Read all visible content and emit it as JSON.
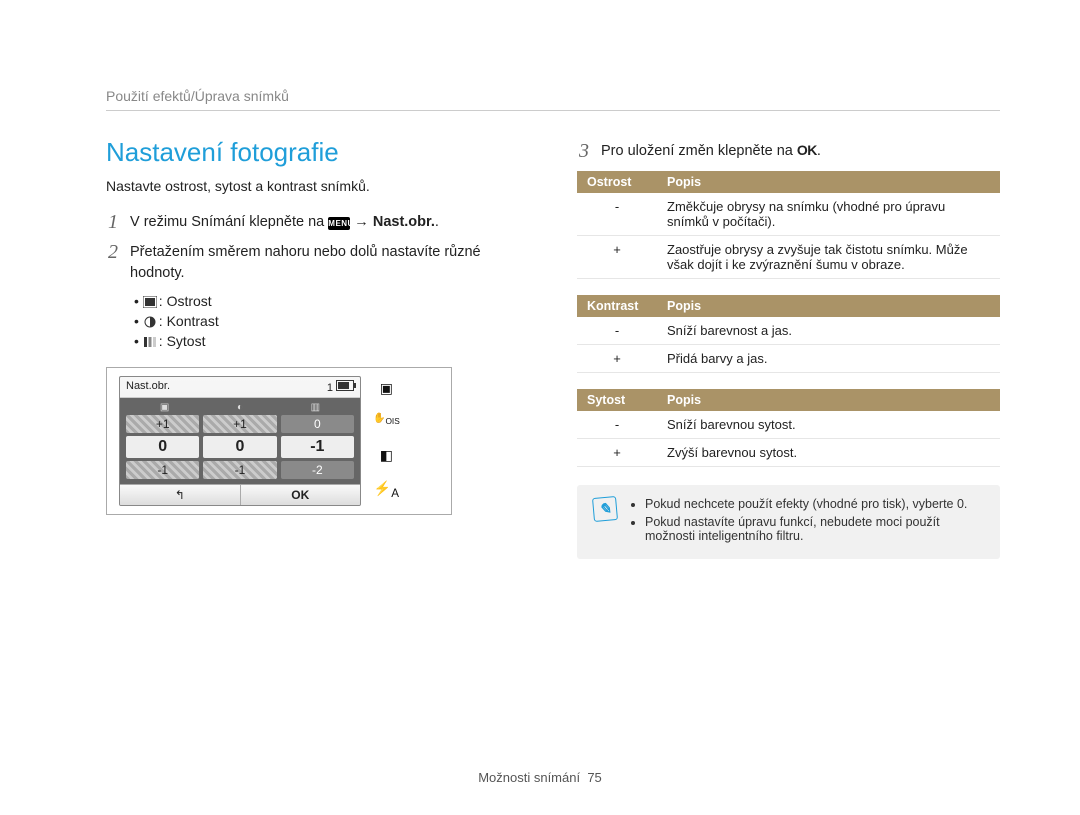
{
  "breadcrumb": "Použití efektů/Úprava snímků",
  "title": "Nastavení fotografie",
  "subtitle": "Nastavte ostrost, sytost a kontrast snímků.",
  "steps": {
    "s1_num": "1",
    "s1_pre": "V režimu Snímání klepněte na ",
    "s1_menu": "MENU",
    "s1_arrow": " → ",
    "s1_target": "Nast.obr.",
    "s1_end": ".",
    "s2_num": "2",
    "s2_text": "Přetažením směrem nahoru nebo dolů nastavíte různé hodnoty.",
    "s3_num": "3",
    "s3_pre": "Pro uložení změn klepněte na ",
    "s3_ok": "OK",
    "s3_end": "."
  },
  "bullets": {
    "b1": ": Ostrost",
    "b2": ": Kontrast",
    "b3": ": Sytost"
  },
  "camera": {
    "topLabel": "Nast.obr.",
    "topNum": "1",
    "r1": [
      "+1",
      "+1",
      "0"
    ],
    "r2": [
      "0",
      "0",
      "-1"
    ],
    "r3": [
      "-1",
      "-1",
      "-2"
    ],
    "back": "↰",
    "ok": "OK"
  },
  "tables": {
    "ostrost": {
      "h1": "Ostrost",
      "h2": "Popis",
      "rows": [
        {
          "sign": "-",
          "desc": "Změkčuje obrysy na snímku (vhodné pro úpravu snímků v počítači)."
        },
        {
          "sign": "+",
          "desc": "Zaostřuje obrysy a zvyšuje tak čistotu snímku. Může však dojít i ke zvýraznění šumu v obraze."
        }
      ]
    },
    "kontrast": {
      "h1": "Kontrast",
      "h2": "Popis",
      "rows": [
        {
          "sign": "-",
          "desc": "Sníží barevnost a jas."
        },
        {
          "sign": "+",
          "desc": "Přidá barvy a jas."
        }
      ]
    },
    "sytost": {
      "h1": "Sytost",
      "h2": "Popis",
      "rows": [
        {
          "sign": "-",
          "desc": "Sníží barevnou sytost."
        },
        {
          "sign": "+",
          "desc": "Zvýší barevnou sytost."
        }
      ]
    }
  },
  "note": {
    "n1": "Pokud nechcete použít efekty (vhodné pro tisk), vyberte 0.",
    "n2": "Pokud nastavíte úpravu funkcí, nebudete moci použít možnosti inteligentního filtru."
  },
  "footer": {
    "section": "Možnosti snímání",
    "page": "75"
  }
}
